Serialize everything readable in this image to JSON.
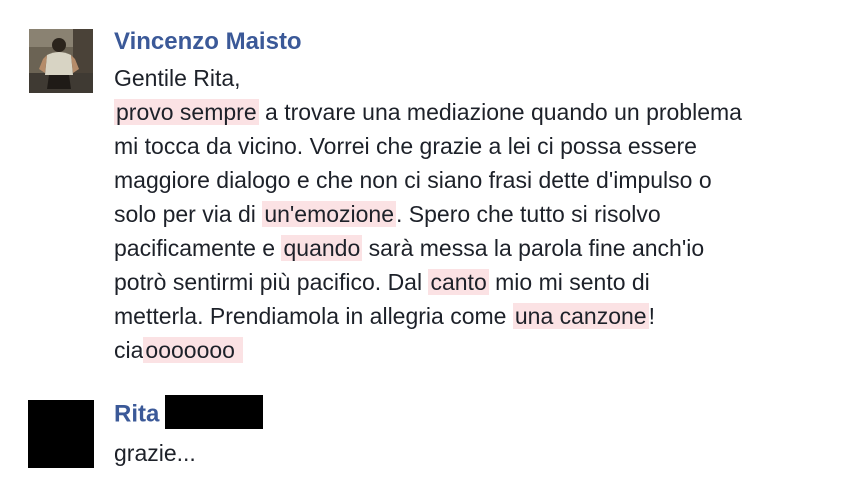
{
  "comments": [
    {
      "author": "Vincenzo Maisto",
      "lines": [
        [
          {
            "t": "Gentile Rita,"
          }
        ],
        [
          {
            "t": "provo sempre",
            "hl": true
          },
          {
            "t": " a trovare una mediazione quando un problema"
          }
        ],
        [
          {
            "t": "mi tocca da vicino. Vorrei che grazie a lei ci possa essere"
          }
        ],
        [
          {
            "t": "maggiore dialogo e che non ci siano frasi dette d'impulso o"
          }
        ],
        [
          {
            "t": "solo per via di "
          },
          {
            "t": "un'emozione",
            "hl": true
          },
          {
            "t": ". Spero che tutto si risolvo"
          }
        ],
        [
          {
            "t": "pacificamente e "
          },
          {
            "t": "quando",
            "hl": true
          },
          {
            "t": " sarà messa la parola fine anch'io"
          }
        ],
        [
          {
            "t": "potrò sentirmi più pacifico. Dal "
          },
          {
            "t": "canto",
            "hl": true
          },
          {
            "t": " mio mi sento di"
          }
        ],
        [
          {
            "t": "metterla. Prendiamola in allegria come "
          },
          {
            "t": "una canzone",
            "hl": true
          },
          {
            "t": "!"
          }
        ],
        [
          {
            "t": "cia"
          },
          {
            "t": "ooooooo ",
            "hl": true
          }
        ]
      ]
    },
    {
      "author": "Rita",
      "lines": [
        [
          {
            "t": "grazie..."
          }
        ]
      ]
    }
  ],
  "colors": {
    "author_link": "#3b5998",
    "highlight": "#fbe2e4",
    "text": "#1d2129",
    "redaction": "#000000"
  }
}
